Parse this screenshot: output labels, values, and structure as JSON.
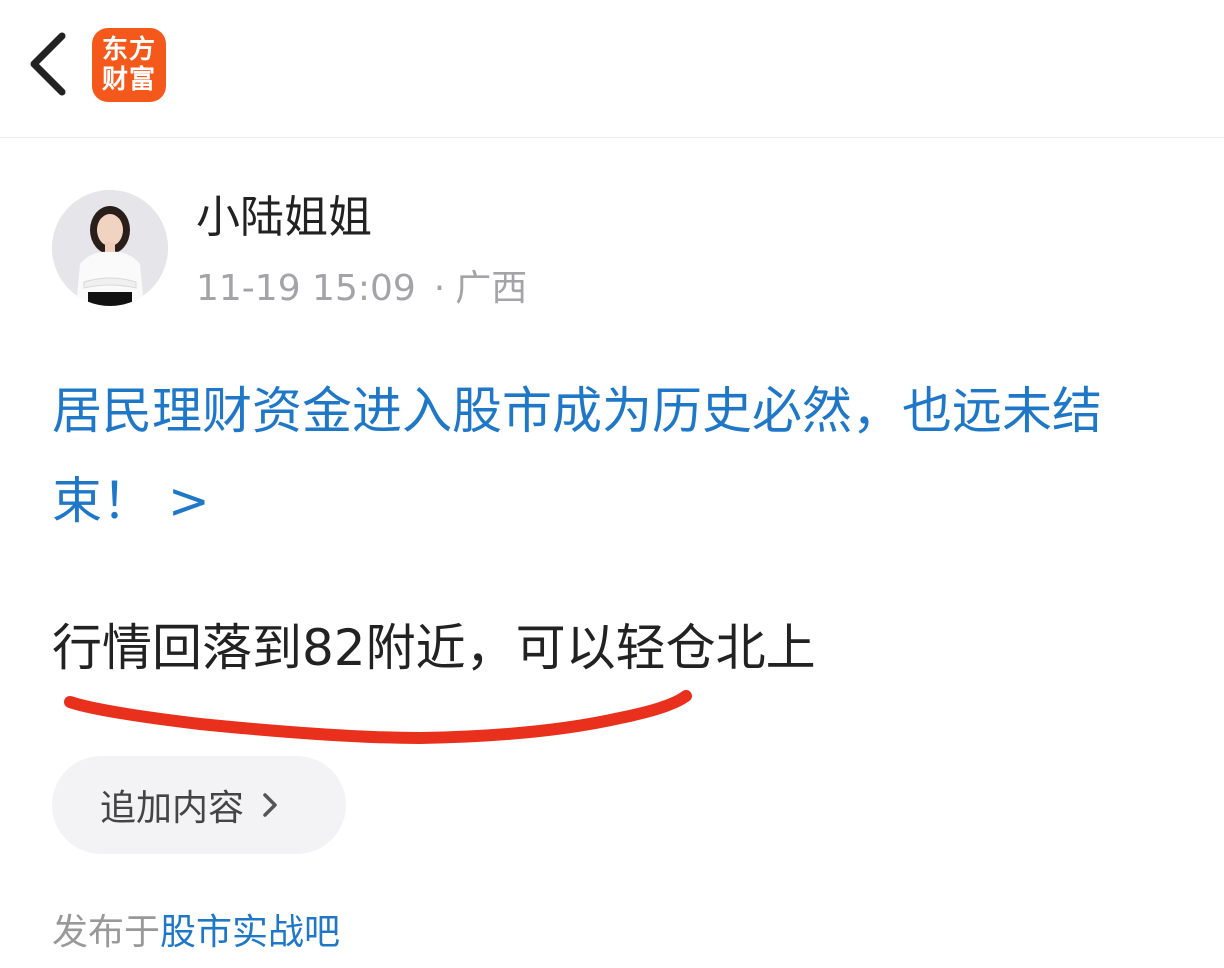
{
  "header": {
    "back_icon": "chevron-left-icon",
    "logo": {
      "line1": "东方",
      "line2": "财富",
      "color": "#f5581b"
    }
  },
  "post": {
    "author": "小陆姐姐",
    "timestamp": "11-19 15:09",
    "separator": "·",
    "location": "广西",
    "headline": "居民理财资金进入股市成为历史必然，也远未结束！ >",
    "body": "行情回落到82附近，可以轻仓北上",
    "underline_color": "#e8301c",
    "append_button": "追加内容",
    "posted_prefix": "发布于",
    "forum": "股市实战吧"
  },
  "colors": {
    "link": "#1f77c8",
    "meta": "#a3a3a8"
  }
}
